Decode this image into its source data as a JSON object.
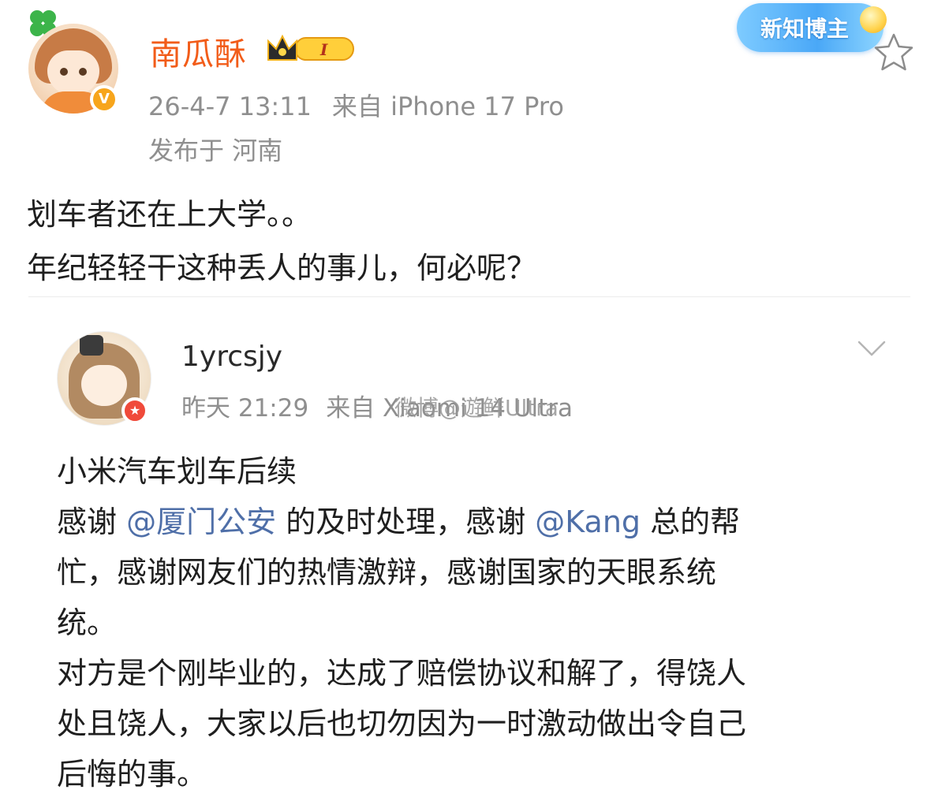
{
  "post": {
    "author": "南瓜酥",
    "level_badge": "I",
    "badge_text": "新知博主",
    "timestamp": "26-4-7 13:11",
    "source": "来自 iPhone 17 Pro",
    "location": "发布于 河南",
    "body_lines": [
      "划车者还在上大学。。",
      "年纪轻轻干这种丢人的事儿，何必呢？"
    ]
  },
  "repost": {
    "author": "1yrcsjy",
    "timestamp": "昨天 21:29",
    "source": "来自 Xiaomi 14 Ultra",
    "watermark": "微博@遊鲜Ultra",
    "title": "小米汽车划车后续",
    "line2_before": "感谢 ",
    "mention1": "@厦门公安",
    "line2_middle": " 的及时处理，感谢 ",
    "mention2": "@Kang",
    "line2_after": " 总的帮",
    "line3": "忙，感谢网友们的热情激辩，感谢国家的天眼系统",
    "line4": "统。",
    "line5": "对方是个刚毕业的，达成了赔偿协议和解了，得饶人",
    "line6": "处且饶人，大家以后也切勿因为一时激动做出令自己",
    "line7": "后悔的事。"
  },
  "colors": {
    "author_orange": "#f25c19",
    "meta_gray": "#8f8f8f",
    "mention_blue": "#4f6fa8"
  },
  "icons": {
    "clover": "clover-icon",
    "verified": "verified-v-icon",
    "crown": "crown-icon",
    "star": "star-outline-icon",
    "chevron": "chevron-down-icon"
  }
}
